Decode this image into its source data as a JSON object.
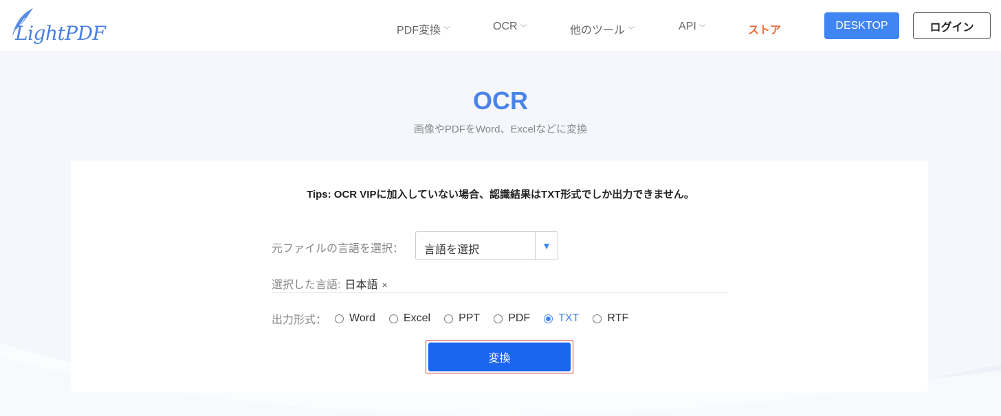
{
  "header": {
    "logo_text": "LightPDF",
    "nav": [
      {
        "label": "PDF変換",
        "has_dropdown": true
      },
      {
        "label": "OCR",
        "has_dropdown": true
      },
      {
        "label": "他のツール",
        "has_dropdown": true
      },
      {
        "label": "API",
        "has_dropdown": true
      },
      {
        "label": "ストア",
        "has_dropdown": false
      }
    ],
    "desktop_label": "DESKTOP",
    "login_label": "ログイン"
  },
  "hero": {
    "title": "OCR",
    "subtitle": "画像やPDFをWord、Excelなどに変換"
  },
  "card": {
    "tips": "Tips: OCR VIPに加入していない場合、認識結果はTXT形式でしか出力できません。",
    "language": {
      "label": "元ファイルの言語を選択：",
      "select_value": "言語を選択",
      "arrow_icon": "triangle-down-icon"
    },
    "selected": {
      "label": "選択した言語:",
      "value": "日本語",
      "remove": "×"
    },
    "format": {
      "label": "出力形式：",
      "options": [
        "Word",
        "Excel",
        "PPT",
        "PDF",
        "TXT",
        "RTF"
      ],
      "selected": "TXT"
    },
    "convert_label": "変換"
  },
  "colors": {
    "accent": "#4b84e8",
    "primary_button": "#1a66f0",
    "store": "#f26b3a",
    "highlight_border": "#d9363e"
  }
}
